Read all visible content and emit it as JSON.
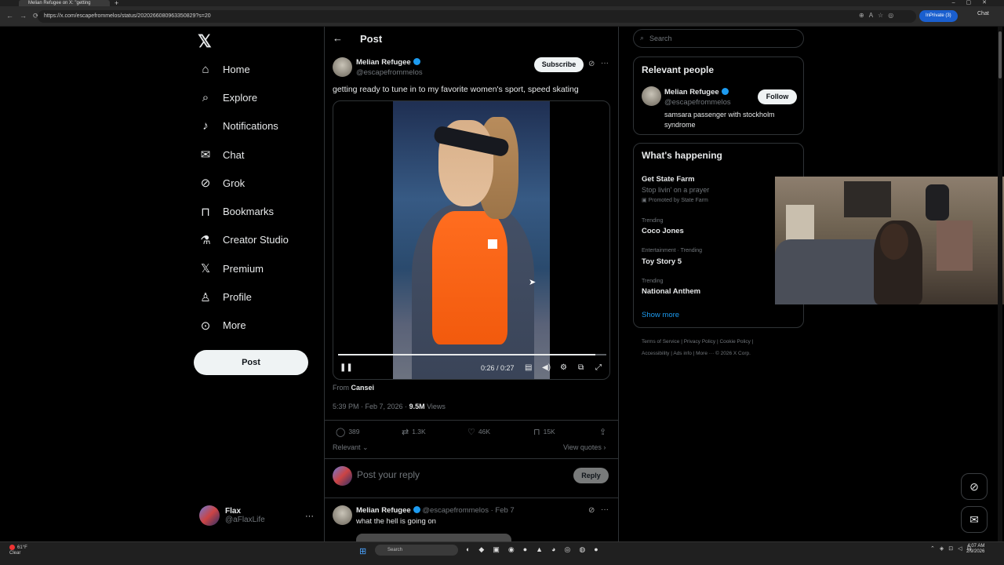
{
  "browser": {
    "tab_title": "Melian Refugee on X: \"getting",
    "url": "https://x.com/escapefrommelos/status/2020266080963350829?s=20",
    "inprivate_label": "InPrivate (3)",
    "chat_label": "Chat"
  },
  "nav": {
    "items": [
      {
        "label": "Home",
        "icon": "home-icon"
      },
      {
        "label": "Explore",
        "icon": "search-icon"
      },
      {
        "label": "Notifications",
        "icon": "bell-icon"
      },
      {
        "label": "Chat",
        "icon": "mail-icon"
      },
      {
        "label": "Grok",
        "icon": "grok-icon"
      },
      {
        "label": "Bookmarks",
        "icon": "bookmark-icon"
      },
      {
        "label": "Creator Studio",
        "icon": "flask-icon"
      },
      {
        "label": "Premium",
        "icon": "x-icon"
      },
      {
        "label": "Profile",
        "icon": "person-icon"
      },
      {
        "label": "More",
        "icon": "more-circle-icon"
      }
    ],
    "post_button": "Post"
  },
  "account": {
    "name": "Flax",
    "handle": "@aFlaxLife"
  },
  "post": {
    "header_title": "Post",
    "author_name": "Melian Refugee",
    "author_handle": "@escapefrommelos",
    "subscribe_label": "Subscribe",
    "text": "getting ready to tune in to my favorite women's sport, speed skating",
    "video": {
      "time": "0:26 / 0:27",
      "progress": 0.96
    },
    "from_label": "From",
    "from_source": "Cansei",
    "timestamp": "5:39 PM · Feb 7, 2026 · ",
    "views_count": "9.5M",
    "views_label": " Views",
    "stats": {
      "replies": "389",
      "reposts": "1.3K",
      "likes": "46K",
      "bookmarks": "15K"
    },
    "relevant_label": "Relevant",
    "view_quotes": "View quotes"
  },
  "reply_box": {
    "placeholder": "Post your reply",
    "button": "Reply"
  },
  "reply": {
    "author_name": "Melian Refugee",
    "meta": "@escapefrommelos · Feb 7",
    "text": "what the hell is going on"
  },
  "sidebar": {
    "search_placeholder": "Search",
    "relevant_people": {
      "title": "Relevant people",
      "name": "Melian Refugee",
      "handle": "@escapefrommelos",
      "follow": "Follow",
      "bio": "samsara passenger with stockholm syndrome"
    },
    "happening": {
      "title": "What's happening",
      "promoted_name": "Get State Farm",
      "promoted_desc": "Stop livin' on a prayer",
      "promoted_by": "Promoted by State Farm",
      "trends": [
        {
          "category": "Trending",
          "name": "Coco Jones"
        },
        {
          "category": "Entertainment · Trending",
          "name": "Toy Story 5"
        },
        {
          "category": "Trending",
          "name": "National Anthem"
        }
      ],
      "show_more": "Show more"
    },
    "footer_line1": "Terms of Service  |  Privacy Policy  |  Cookie Policy  |",
    "footer_line2": "Accessibility  |  Ads info  |  More ···  © 2026 X Corp."
  },
  "taskbar": {
    "weather_temp": "61°F",
    "weather_desc": "Clear",
    "search_placeholder": "Search",
    "time": "4:07 AM",
    "date": "2/9/2026"
  }
}
